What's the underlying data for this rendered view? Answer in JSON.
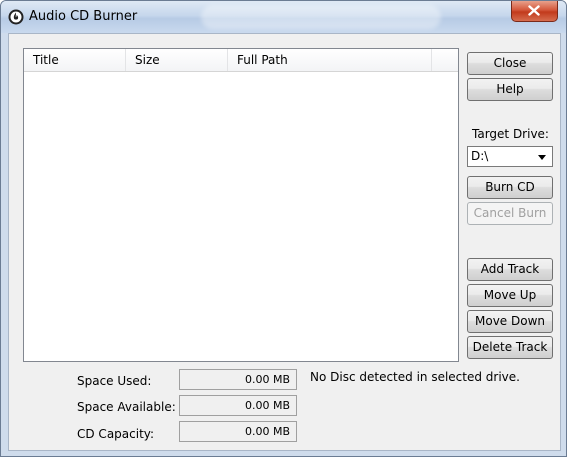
{
  "window": {
    "title": "Audio CD Burner"
  },
  "list": {
    "columns": [
      "Title",
      "Size",
      "Full Path"
    ]
  },
  "buttons": {
    "close": "Close",
    "help": "Help",
    "burn_cd": "Burn CD",
    "cancel_burn": "Cancel Burn",
    "add_track": "Add Track",
    "move_up": "Move Up",
    "move_down": "Move Down",
    "delete_track": "Delete Track"
  },
  "target_drive": {
    "label": "Target Drive:",
    "selected": "D:\\"
  },
  "stats": {
    "space_used_label": "Space Used:",
    "space_used_value": "0.00 MB",
    "space_available_label": "Space Available:",
    "space_available_value": "0.00 MB",
    "cd_capacity_label": "CD Capacity:",
    "cd_capacity_value": "0.00 MB"
  },
  "status": {
    "message": "No Disc detected in selected drive."
  },
  "icons": {
    "app": "burner-app-icon",
    "close": "close-icon"
  },
  "colors": {
    "close_button": "#c8432a",
    "titlebar": "#c6d7ec"
  }
}
